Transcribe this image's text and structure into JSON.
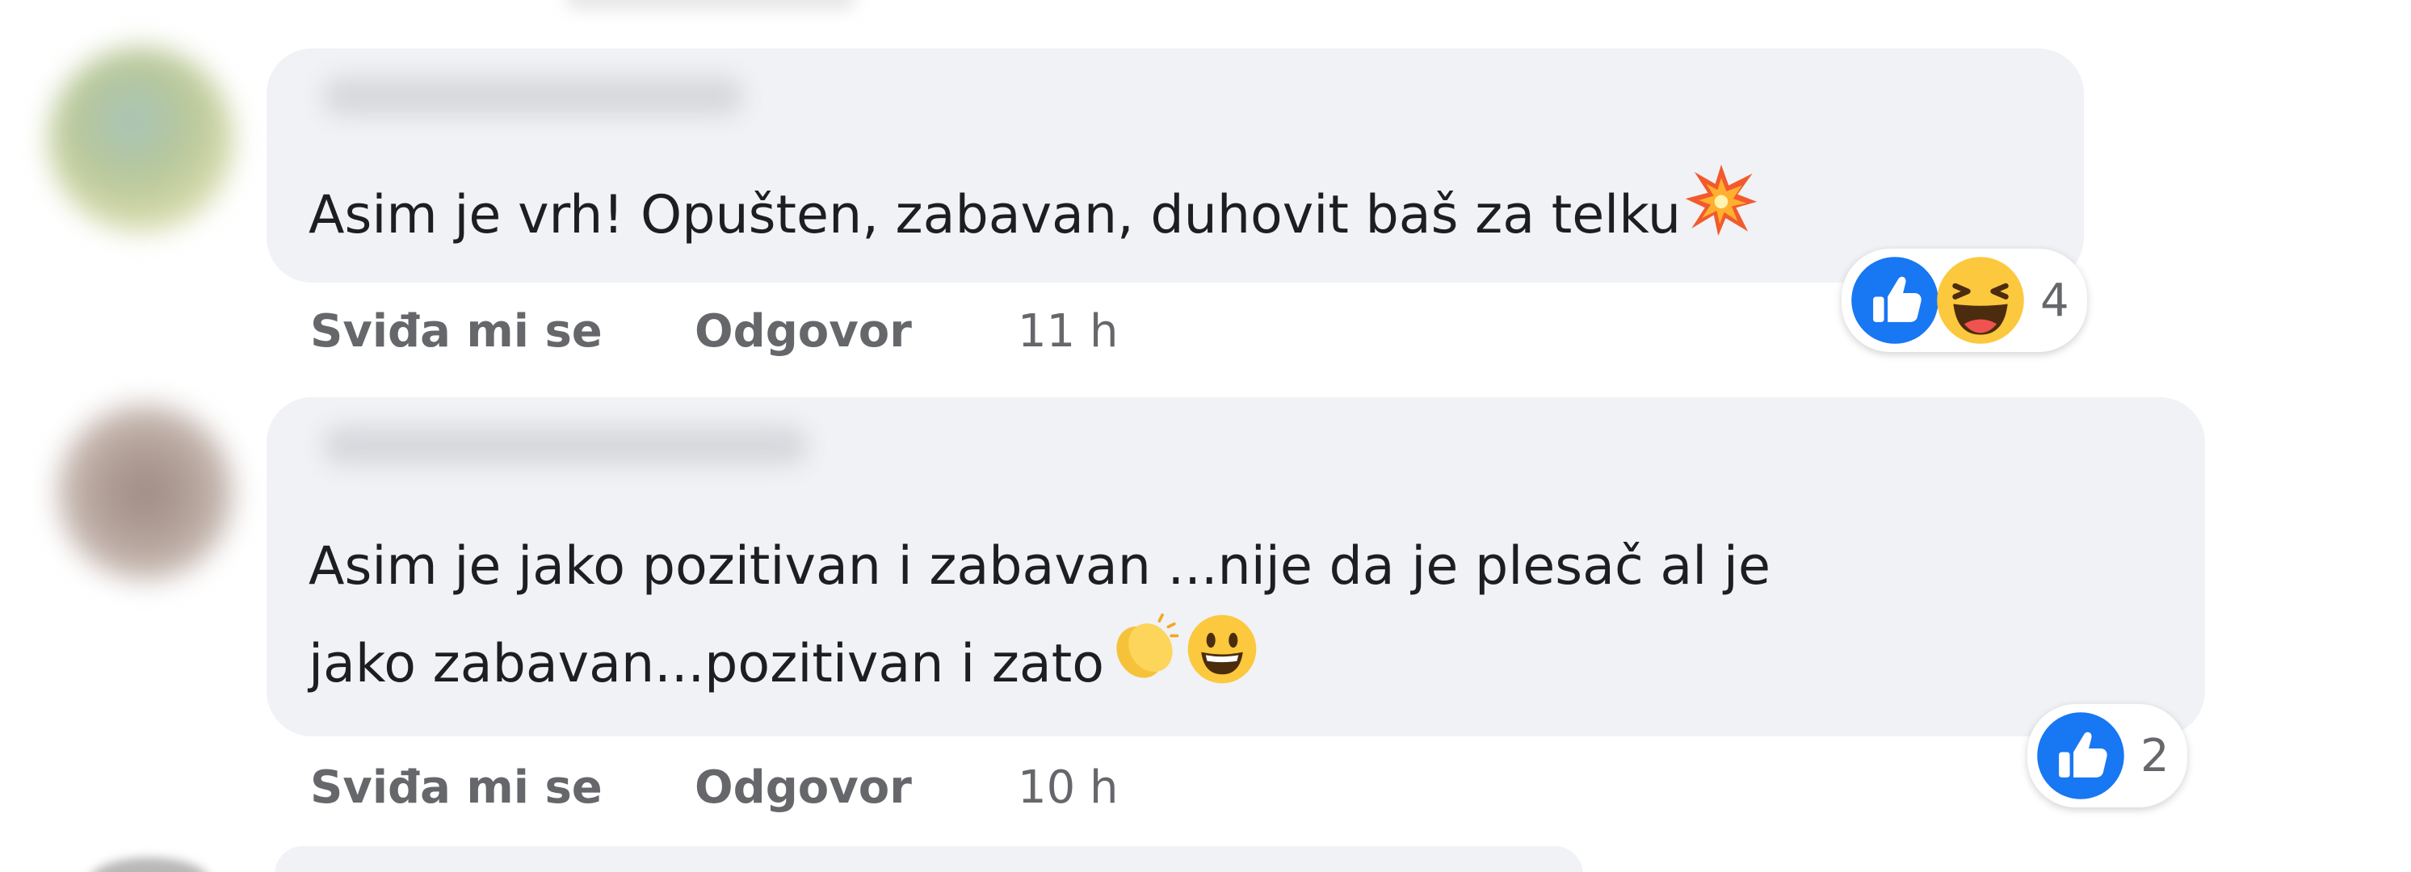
{
  "comments": [
    {
      "text": "Asim je vrh! Opušten, zabavan, duhovit baš za telku",
      "emojis": [
        "collision-icon"
      ],
      "actions": {
        "like_label": "Sviđa mi se",
        "reply_label": "Odgovor",
        "timestamp": "11 h"
      },
      "reactions": {
        "icons": [
          "like-icon",
          "haha-icon"
        ],
        "count": "4"
      }
    },
    {
      "text_line1": "Asim je jako pozitivan i zabavan ...nije da je plesač al je",
      "text_line2": "jako zabavan...pozitivan i zato",
      "emojis": [
        "clapping-hands-icon",
        "grinning-face-icon"
      ],
      "actions": {
        "like_label": "Sviđa mi se",
        "reply_label": "Odgovor",
        "timestamp": "10 h"
      },
      "reactions": {
        "icons": [
          "like-icon"
        ],
        "count": "2"
      }
    }
  ],
  "colors": {
    "bubble": "#f0f2f5",
    "text": "#1c1e21",
    "secondary_text": "#65676b",
    "like_blue": "#1877f2",
    "haha_yellow": "#fcc83d"
  }
}
